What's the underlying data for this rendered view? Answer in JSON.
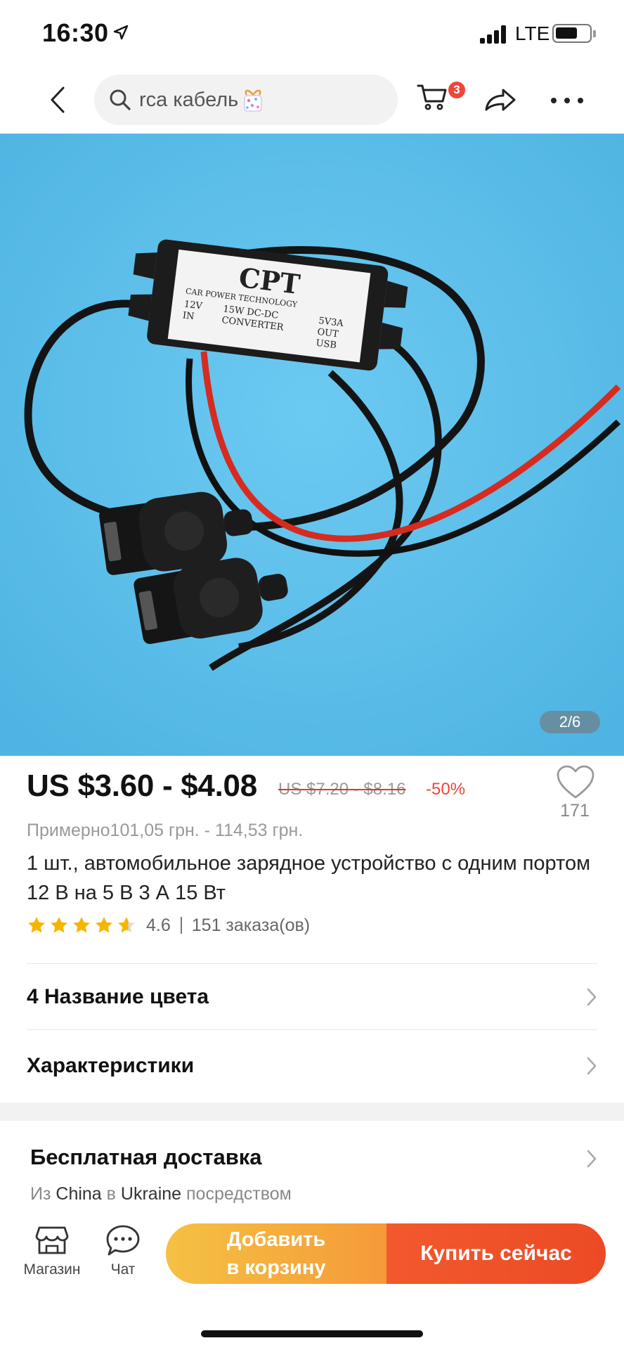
{
  "status_bar": {
    "time": "16:30",
    "network": "LTE"
  },
  "header": {
    "search_text": "rca кабель",
    "cart_badge": "3",
    "icons": [
      "back-icon",
      "search-icon",
      "gift-icon",
      "cart-icon",
      "share-icon",
      "more-icon"
    ]
  },
  "gallery": {
    "counter": "2/6",
    "image_label_brand": "CPT",
    "image_label_line1": "CAR POWER TECHNOLOGY",
    "image_label_left": [
      "12V",
      "IN"
    ],
    "image_label_center": [
      "15W DC-DC",
      "CONVERTER"
    ],
    "image_label_right": [
      "5V3A",
      "OUT",
      "USB"
    ],
    "background_color": "#5fbfea"
  },
  "product": {
    "price": "US $3.60 - $4.08",
    "old_price": "US $7.20 - $8.16",
    "discount": "-50%",
    "wishlist_count": "171",
    "approx_price": "Примерно101,05 грн. - 114,53 грн.",
    "title": "1 шт., автомобильное зарядное устройство с одним портом 12 В на 5 В 3 А 15 Вт",
    "rating": "4.6",
    "rating_stars": 4.6,
    "orders": "151 заказа(ов)"
  },
  "options": {
    "color_row": "4 Название цвета",
    "specs_row": "Характеристики"
  },
  "shipping": {
    "title": "Бесплатная доставка",
    "from_prefix": "Из",
    "from_country": "China",
    "to_prefix": "в",
    "to_country": "Ukraine",
    "suffix": "посредством"
  },
  "bottom_bar": {
    "store_label": "Магазин",
    "chat_label": "Чат",
    "add_to_cart_line1": "Добавить",
    "add_to_cart_line2": "в корзину",
    "buy_now": "Купить сейчас"
  },
  "colors": {
    "accent_red": "#f0453a",
    "cart_btn": "#f5a83d",
    "buy_btn": "#ee4f28",
    "star": "#f7b500"
  }
}
